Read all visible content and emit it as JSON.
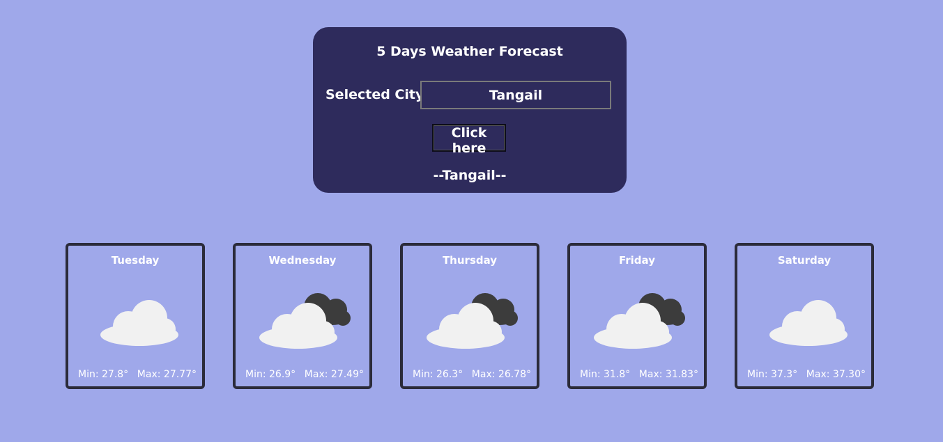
{
  "panel": {
    "title": "5 Days Weather Forecast",
    "city_label": "Selected City:",
    "city_value": "Tangail",
    "button_label": "Click here",
    "city_display": "--Tangail--"
  },
  "colors": {
    "background": "#9fa8ea",
    "panel": "#2e2b5c",
    "card_border": "#2b2b3a"
  },
  "days": [
    {
      "name": "Tuesday",
      "icon": "cloud-icon",
      "min": "Min: 27.8°",
      "max": "Max: 27.77°"
    },
    {
      "name": "Wednesday",
      "icon": "cloudy-icon",
      "min": "Min: 26.9°",
      "max": "Max: 27.49°"
    },
    {
      "name": "Thursday",
      "icon": "cloudy-icon",
      "min": "Min: 26.3°",
      "max": "Max: 26.78°"
    },
    {
      "name": "Friday",
      "icon": "cloudy-icon",
      "min": "Min: 31.8°",
      "max": "Max: 31.83°"
    },
    {
      "name": "Saturday",
      "icon": "cloud-icon",
      "min": "Min: 37.3°",
      "max": "Max: 37.30°"
    }
  ]
}
